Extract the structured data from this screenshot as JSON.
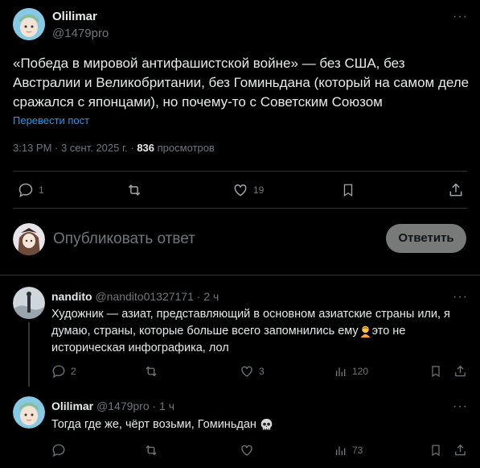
{
  "post": {
    "author_name": "Olilimar",
    "author_handle": "@1479pro",
    "text": "«Победа в мировой антифашистской войне» — без США, без Австралии и Великобритании, без Гоминьдана (который на самом деле сражался с японцами), но почему-то с Советским Союзом",
    "translate": "Перевести пост",
    "time": "3:13 PM · 3 сент. 2025 г. · ",
    "views_count": "836",
    "views_label": " просмотров",
    "replies": "1",
    "likes": "19"
  },
  "composer": {
    "placeholder": "Опубликовать ответ",
    "button": "Ответить"
  },
  "replies": [
    {
      "author_name": "nandito",
      "author_handle": "@nandito01327171",
      "time": "· 2 ч",
      "text": "Художник — азиат, представляющий в основном азиатские страны или, я думаю, страны, которые больше всего запомнились ему",
      "text_tail": "это не историческая инфографика, лол",
      "replies": "2",
      "likes": "3",
      "views": "120"
    },
    {
      "author_name": "Olilimar",
      "author_handle": "@1479pro",
      "time": "· 1 ч",
      "text": "Тогда где же, чёрт возьми, Гоминьдан",
      "views": "73"
    }
  ],
  "colors": {
    "accent": "#1d9bf0",
    "background": "#000000",
    "divider": "#2f3336",
    "muted": "#71767b"
  }
}
